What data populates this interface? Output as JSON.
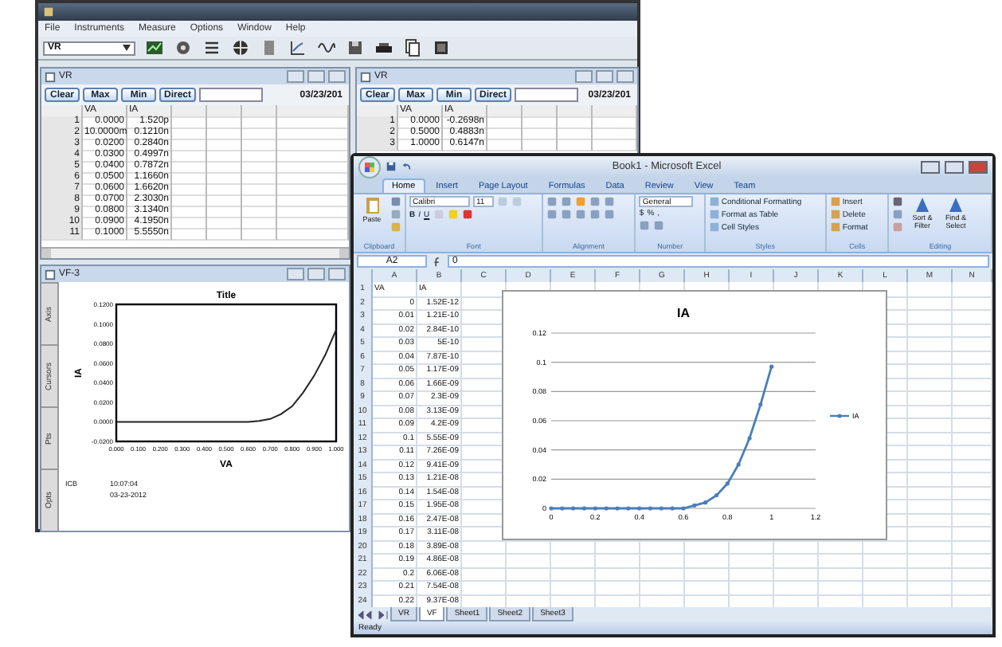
{
  "app_window": {
    "menu": [
      "File",
      "Instruments",
      "Measure",
      "Options",
      "Window",
      "Help"
    ],
    "instrument_select": {
      "value": "VR"
    },
    "tables": [
      {
        "title": "VR",
        "buttons": [
          "Clear",
          "Max",
          "Min",
          "Direct"
        ],
        "date": "03/23/201",
        "columns": [
          "VA",
          "IA"
        ],
        "rows": [
          {
            "index": "1",
            "va": "0.0000",
            "ia": "1.520p"
          },
          {
            "index": "2",
            "va": "10.0000m",
            "ia": "0.1210n"
          },
          {
            "index": "3",
            "va": "0.0200",
            "ia": "0.2840n"
          },
          {
            "index": "4",
            "va": "0.0300",
            "ia": "0.4997n"
          },
          {
            "index": "5",
            "va": "0.0400",
            "ia": "0.7872n"
          },
          {
            "index": "6",
            "va": "0.0500",
            "ia": "1.1660n"
          },
          {
            "index": "7",
            "va": "0.0600",
            "ia": "1.6620n"
          },
          {
            "index": "8",
            "va": "0.0700",
            "ia": "2.3030n"
          },
          {
            "index": "9",
            "va": "0.0800",
            "ia": "3.1340n"
          },
          {
            "index": "10",
            "va": "0.0900",
            "ia": "4.1950n"
          },
          {
            "index": "11",
            "va": "0.1000",
            "ia": "5.5550n"
          }
        ]
      },
      {
        "title": "VR",
        "buttons": [
          "Clear",
          "Max",
          "Min",
          "Direct"
        ],
        "date": "03/23/201",
        "columns": [
          "VA",
          "IA"
        ],
        "rows": [
          {
            "index": "1",
            "va": "0.0000",
            "ia": "-0.2698n"
          },
          {
            "index": "2",
            "va": "0.5000",
            "ia": "0.4883n"
          },
          {
            "index": "3",
            "va": "1.0000",
            "ia": "0.6147n"
          }
        ]
      }
    ],
    "graph": {
      "title": "VF-3",
      "side_tabs": [
        "Axis",
        "Cursors",
        "Pts",
        "Opts"
      ],
      "chart_data": {
        "type": "line",
        "title": "Title",
        "xlabel": "VA",
        "ylabel": "IA",
        "x": [
          0,
          0.1,
          0.2,
          0.3,
          0.4,
          0.5,
          0.55,
          0.6,
          0.65,
          0.7,
          0.75,
          0.8,
          0.85,
          0.9,
          0.95,
          1.0
        ],
        "values": [
          0,
          0,
          0,
          0,
          0,
          0,
          0,
          0,
          0.001,
          0.003,
          0.008,
          0.016,
          0.03,
          0.047,
          0.068,
          0.094
        ],
        "xlim": [
          0,
          1.0
        ],
        "ylim": [
          -0.02,
          0.12
        ],
        "xticks": [
          {
            "value": 0,
            "label": "0.000"
          },
          {
            "value": 0.1,
            "label": "0.100"
          },
          {
            "value": 0.2,
            "label": "0.200"
          },
          {
            "value": 0.3,
            "label": "0.300"
          },
          {
            "value": 0.4,
            "label": "0.400"
          },
          {
            "value": 0.5,
            "label": "0.500"
          },
          {
            "value": 0.6,
            "label": "0.600"
          },
          {
            "value": 0.7,
            "label": "0.700"
          },
          {
            "value": 0.8,
            "label": "0.800"
          },
          {
            "value": 0.9,
            "label": "0.900"
          },
          {
            "value": 1.0,
            "label": "1.000"
          }
        ],
        "yticks": [
          {
            "value": -0.02,
            "label": "-0.0200"
          },
          {
            "value": 0,
            "label": "0.0000"
          },
          {
            "value": 0.02,
            "label": "0.0200"
          },
          {
            "value": 0.04,
            "label": "0.0400"
          },
          {
            "value": 0.06,
            "label": "0.0600"
          },
          {
            "value": 0.08,
            "label": "0.0800"
          },
          {
            "value": 0.1,
            "label": "0.1000"
          },
          {
            "value": 0.12,
            "label": "0.1200"
          }
        ]
      },
      "footer": {
        "label": "ICB",
        "time": "10:07:04",
        "date": "03-23-2012"
      }
    }
  },
  "excel_window": {
    "title": "Book1 - Microsoft Excel",
    "ribbon_tabs": [
      {
        "label": "Home",
        "selected": true
      },
      {
        "label": "Insert",
        "selected": false
      },
      {
        "label": "Page Layout",
        "selected": false
      },
      {
        "label": "Formulas",
        "selected": false
      },
      {
        "label": "Data",
        "selected": false
      },
      {
        "label": "Review",
        "selected": false
      },
      {
        "label": "View",
        "selected": false
      },
      {
        "label": "Team",
        "selected": false
      }
    ],
    "clipboard": {
      "paste": "Paste",
      "label": "Clipboard"
    },
    "font": {
      "name": "Calibri",
      "size": "11",
      "style_buttons": [
        "B",
        "I",
        "U"
      ],
      "label": "Font"
    },
    "alignment": {
      "label": "Alignment"
    },
    "number": {
      "format": "General",
      "symbols": [
        "$",
        "%",
        ","
      ],
      "label": "Number"
    },
    "styles": {
      "items": [
        "Conditional Formatting",
        "Format as Table",
        "Cell Styles"
      ],
      "label": "Styles"
    },
    "cells": {
      "items": [
        "Insert",
        "Delete",
        "Format"
      ],
      "label": "Cells"
    },
    "editing": {
      "items": [
        "Sort & Filter",
        "Find & Select"
      ],
      "label": "Editing"
    },
    "name_box": "A2",
    "formula": "0",
    "columns": [
      "A",
      "B",
      "C",
      "D",
      "E",
      "F",
      "G",
      "H",
      "I",
      "J",
      "K",
      "L",
      "M",
      "N"
    ],
    "rows": [
      {
        "n": "1",
        "a": "VA",
        "b": "IA"
      },
      {
        "n": "2",
        "a": "0",
        "b": "1.52E-12"
      },
      {
        "n": "3",
        "a": "0.01",
        "b": "1.21E-10"
      },
      {
        "n": "4",
        "a": "0.02",
        "b": "2.84E-10"
      },
      {
        "n": "5",
        "a": "0.03",
        "b": "5E-10"
      },
      {
        "n": "6",
        "a": "0.04",
        "b": "7.87E-10"
      },
      {
        "n": "7",
        "a": "0.05",
        "b": "1.17E-09"
      },
      {
        "n": "8",
        "a": "0.06",
        "b": "1.66E-09"
      },
      {
        "n": "9",
        "a": "0.07",
        "b": "2.3E-09"
      },
      {
        "n": "10",
        "a": "0.08",
        "b": "3.13E-09"
      },
      {
        "n": "11",
        "a": "0.09",
        "b": "4.2E-09"
      },
      {
        "n": "12",
        "a": "0.1",
        "b": "5.55E-09"
      },
      {
        "n": "13",
        "a": "0.11",
        "b": "7.26E-09"
      },
      {
        "n": "14",
        "a": "0.12",
        "b": "9.41E-09"
      },
      {
        "n": "15",
        "a": "0.13",
        "b": "1.21E-08"
      },
      {
        "n": "16",
        "a": "0.14",
        "b": "1.54E-08"
      },
      {
        "n": "17",
        "a": "0.15",
        "b": "1.95E-08"
      },
      {
        "n": "18",
        "a": "0.16",
        "b": "2.47E-08"
      },
      {
        "n": "19",
        "a": "0.17",
        "b": "3.11E-08"
      },
      {
        "n": "20",
        "a": "0.18",
        "b": "3.89E-08"
      },
      {
        "n": "21",
        "a": "0.19",
        "b": "4.86E-08"
      },
      {
        "n": "22",
        "a": "0.2",
        "b": "6.06E-08"
      },
      {
        "n": "23",
        "a": "0.21",
        "b": "7.54E-08"
      },
      {
        "n": "24",
        "a": "0.22",
        "b": "9.37E-08"
      }
    ],
    "chart": {
      "chart_data": {
        "type": "line",
        "title": "IA",
        "x": [
          0,
          0.05,
          0.1,
          0.15,
          0.2,
          0.25,
          0.3,
          0.35,
          0.4,
          0.45,
          0.5,
          0.55,
          0.6,
          0.65,
          0.7,
          0.75,
          0.8,
          0.85,
          0.9,
          0.95,
          1.0
        ],
        "series": [
          {
            "name": "IA",
            "color": "#4a7ebb",
            "values": [
              0,
              0,
              0,
              0,
              0,
              0,
              0,
              0,
              0,
              0,
              0,
              0,
              0,
              0.002,
              0.004,
              0.009,
              0.017,
              0.03,
              0.048,
              0.071,
              0.097
            ]
          }
        ],
        "grid": true,
        "xlim": [
          0,
          1.2
        ],
        "ylim": [
          0,
          0.12
        ],
        "xticks": [
          0,
          0.2,
          0.4,
          0.6,
          0.8,
          1,
          1.2
        ],
        "yticks": [
          0,
          0.02,
          0.04,
          0.06,
          0.08,
          0.1,
          0.12
        ]
      }
    },
    "sheet_tabs": [
      {
        "label": "VR",
        "selected": false
      },
      {
        "label": "VF",
        "selected": true
      },
      {
        "label": "Sheet1",
        "selected": false
      },
      {
        "label": "Sheet2",
        "selected": false
      },
      {
        "label": "Sheet3",
        "selected": false
      }
    ],
    "status": "Ready"
  }
}
